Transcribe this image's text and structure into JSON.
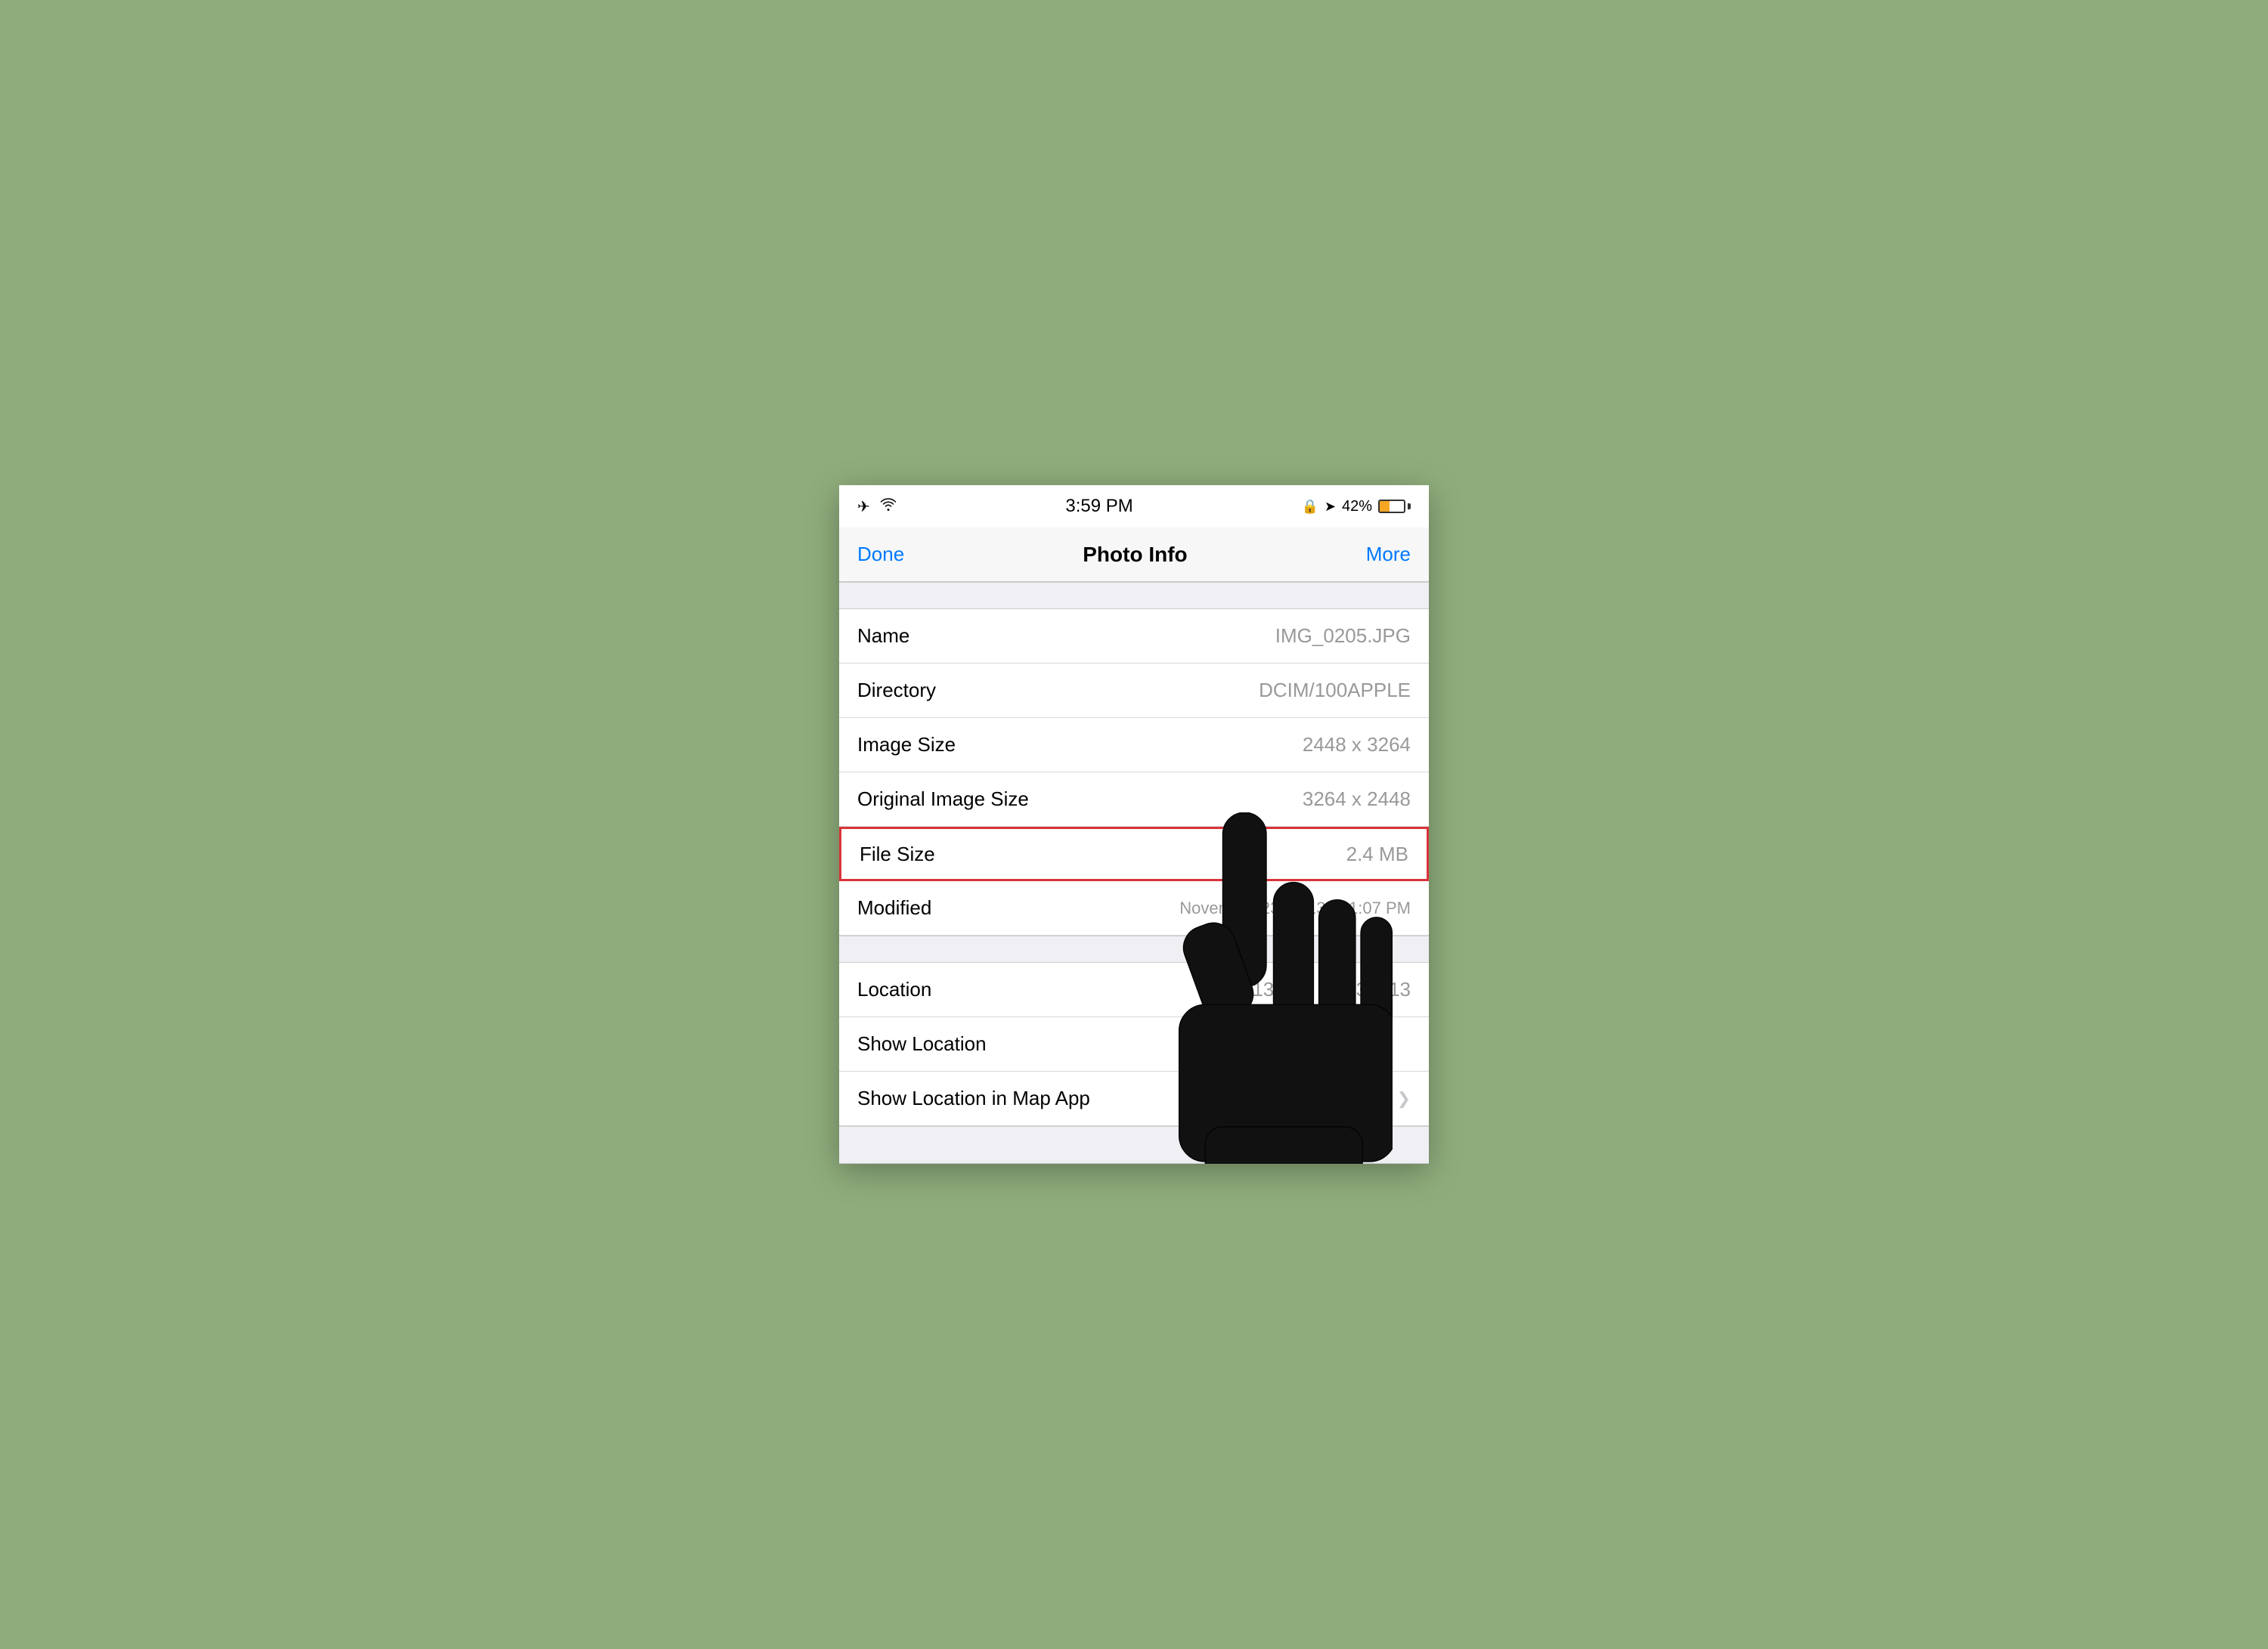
{
  "status_bar": {
    "time": "3:59 PM",
    "battery_percent": "42%"
  },
  "nav": {
    "done_label": "Done",
    "title": "Photo Info",
    "more_label": "More"
  },
  "rows": [
    {
      "label": "Name",
      "value": "IMG_0205.JPG",
      "highlighted": false
    },
    {
      "label": "Directory",
      "value": "DCIM/100APPLE",
      "highlighted": false
    },
    {
      "label": "Image Size",
      "value": "2448 x 3264",
      "highlighted": false
    },
    {
      "label": "Original Image Size",
      "value": "3264 x 2448",
      "highlighted": false
    },
    {
      "label": "File Size",
      "value": "2.4 MB",
      "highlighted": true
    }
  ],
  "modified_row": {
    "label": "Modified",
    "value": "November 23, 2013 at 1:07 PM"
  },
  "location_rows": [
    {
      "label": "Location",
      "value": "31.13132, 121.36213",
      "has_chevron": false
    },
    {
      "label": "Show Location",
      "value": "",
      "has_chevron": false
    },
    {
      "label": "Show Location in Map App",
      "value": "",
      "has_chevron": true
    }
  ],
  "icons": {
    "airplane": "✈",
    "wifi": "wifi-icon",
    "lock": "🔒",
    "location_arrow": "➤",
    "chevron": "❯"
  }
}
